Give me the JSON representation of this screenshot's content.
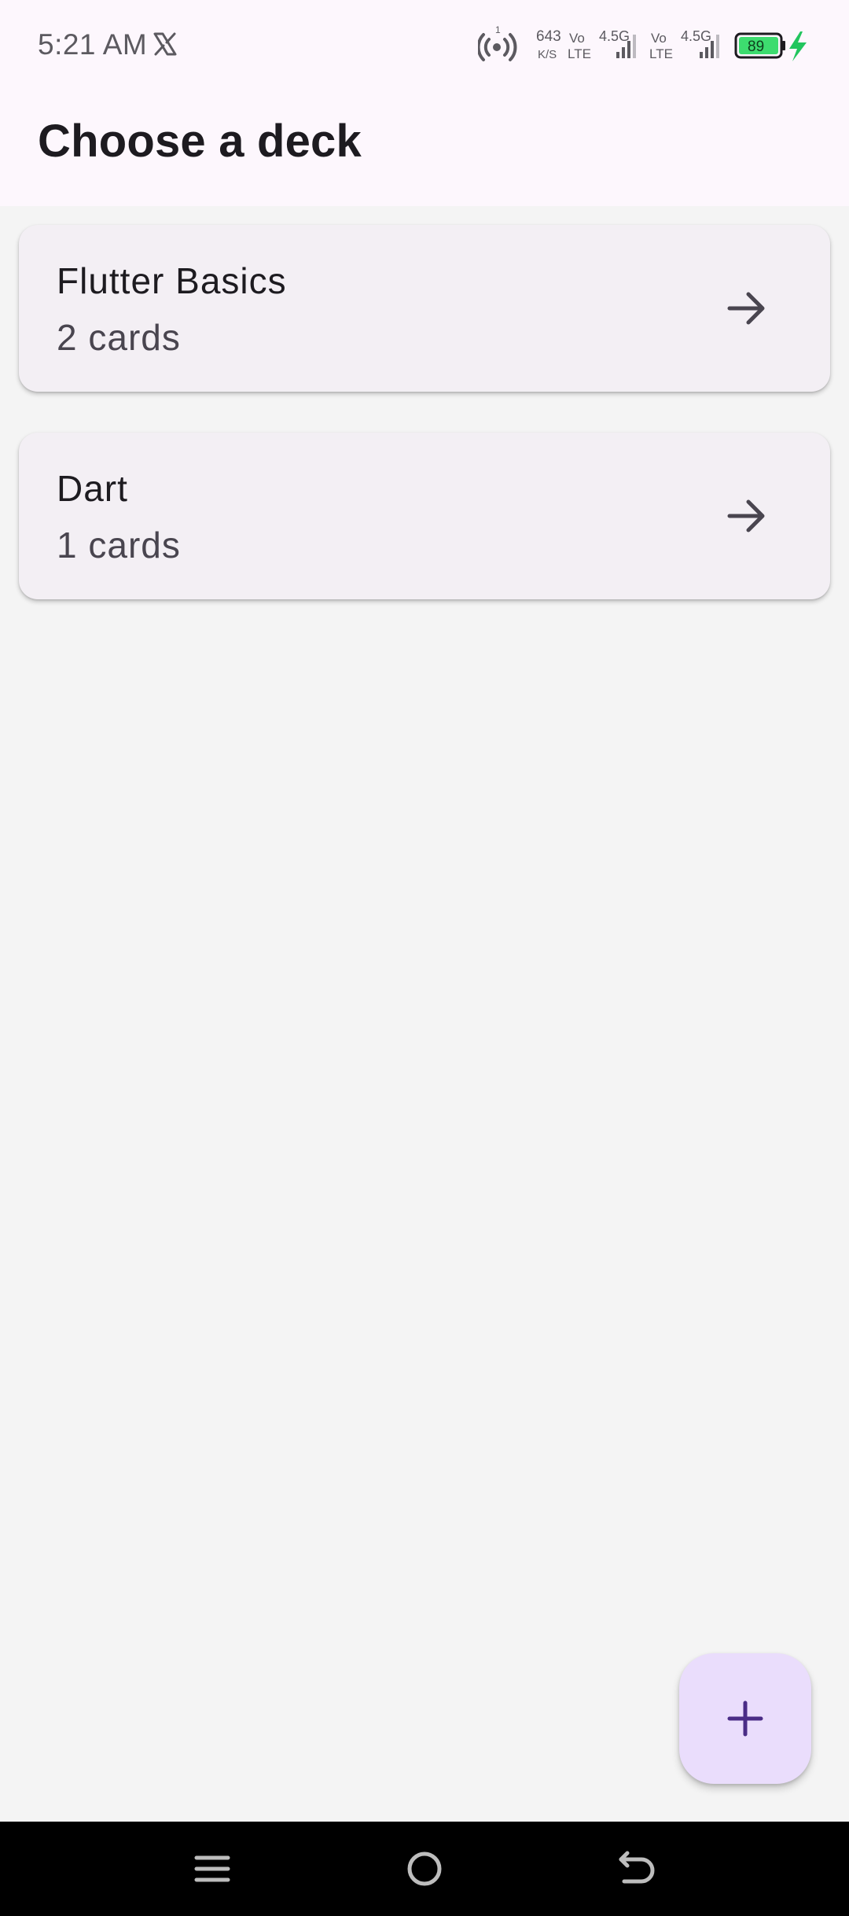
{
  "status_bar": {
    "time": "5:21 AM",
    "net_speed_value": "643",
    "net_speed_unit": "K/S",
    "sim1_vo": "Vo",
    "sim1_lte": "LTE",
    "sim1_network": "4.5G",
    "sim2_vo": "Vo",
    "sim2_lte": "LTE",
    "sim2_network": "4.5G",
    "battery_level": "89",
    "battery_color": "#3ddc6f",
    "charging_color": "#22c55e"
  },
  "app_bar": {
    "title": "Choose a deck"
  },
  "decks": [
    {
      "title": "Flutter Basics",
      "count_label": "2 cards"
    },
    {
      "title": "Dart",
      "count_label": "1 cards"
    }
  ],
  "fab": {
    "icon": "plus-icon",
    "color": "#eaddfc",
    "icon_color": "#4a2c86"
  },
  "nav_bar": {
    "buttons": [
      "menu-icon",
      "home-icon",
      "back-icon"
    ]
  },
  "colors": {
    "accent": "#4a2c86",
    "card_background": "#f3eff4",
    "app_bar_background": "#fdf7fd"
  }
}
